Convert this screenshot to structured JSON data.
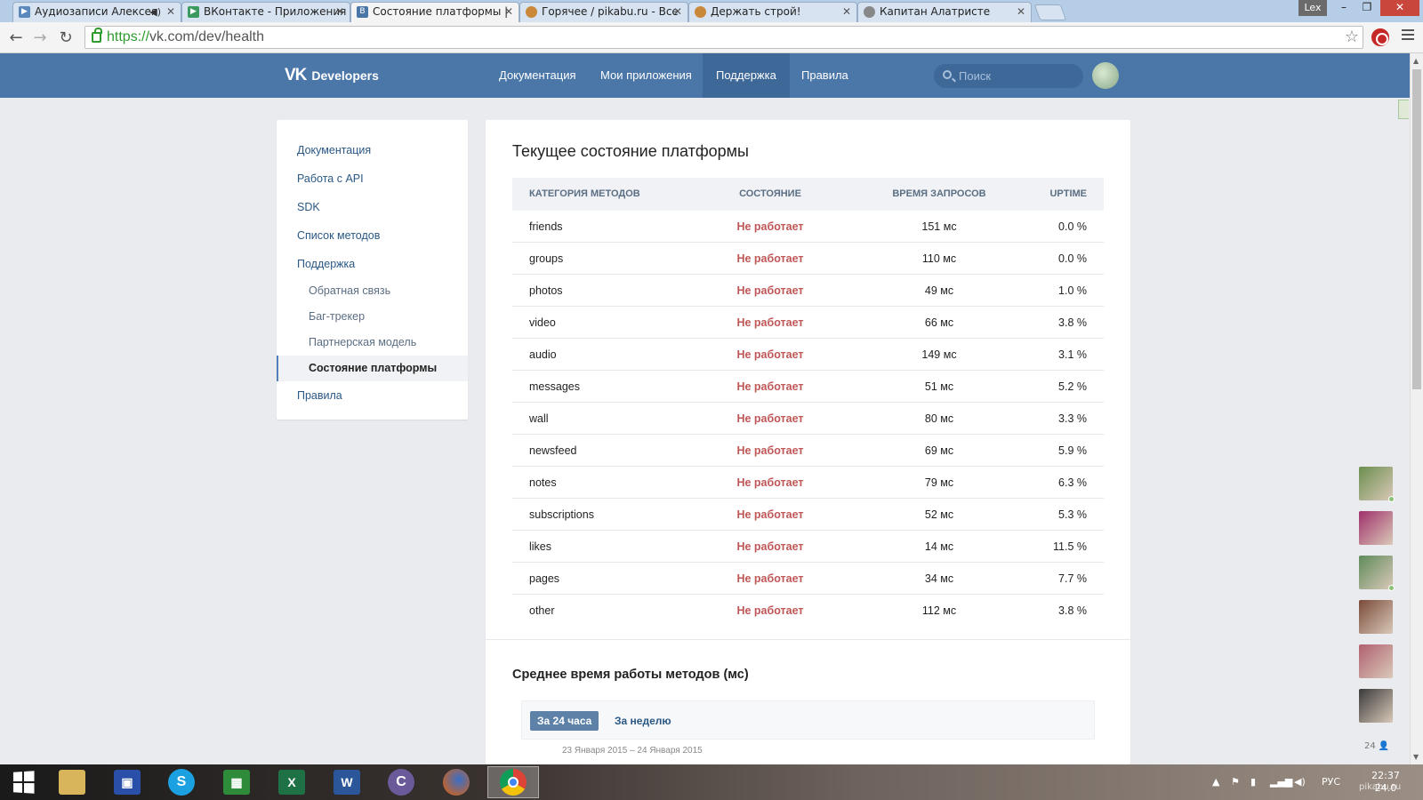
{
  "browser": {
    "tabs": [
      {
        "title": "Аудиозаписи Алексея",
        "favicon_color": "#5b88bd"
      },
      {
        "title": "ВКонтакте - Приложения",
        "favicon_color": "#3c9a5f"
      },
      {
        "title": "Состояние платформы |",
        "favicon_color": "#4a76a8",
        "favicon_letter": "B"
      },
      {
        "title": "Горячее / pikabu.ru - Все",
        "favicon_color": "#c9883a"
      },
      {
        "title": "Держать строй!",
        "favicon_color": "#c9883a"
      },
      {
        "title": "Капитан Алатристе",
        "favicon_color": "#888888"
      }
    ],
    "window_user": "Lex",
    "url_scheme": "https://",
    "url_rest": "vk.com/dev/health"
  },
  "header": {
    "logo_text": "Developers",
    "nav": [
      "Документация",
      "Мои приложения",
      "Поддержка",
      "Правила"
    ],
    "search_placeholder": "Поиск"
  },
  "sidebar": {
    "items": [
      {
        "label": "Документация"
      },
      {
        "label": "Работа с API"
      },
      {
        "label": "SDK"
      },
      {
        "label": "Список методов"
      },
      {
        "label": "Поддержка"
      }
    ],
    "sub_items": [
      {
        "label": "Обратная связь"
      },
      {
        "label": "Баг-трекер"
      },
      {
        "label": "Партнерская модель"
      },
      {
        "label": "Состояние платформы"
      }
    ],
    "last_item": "Правила"
  },
  "main": {
    "title": "Текущее состояние платформы",
    "columns": [
      "КАТЕГОРИЯ МЕТОДОВ",
      "СОСТОЯНИЕ",
      "ВРЕМЯ ЗАПРОСОВ",
      "UPTIME"
    ],
    "rows": [
      {
        "category": "friends",
        "status": "Не работает",
        "time": "151 мс",
        "uptime": "0.0 %"
      },
      {
        "category": "groups",
        "status": "Не работает",
        "time": "110 мс",
        "uptime": "0.0 %"
      },
      {
        "category": "photos",
        "status": "Не работает",
        "time": "49 мс",
        "uptime": "1.0 %"
      },
      {
        "category": "video",
        "status": "Не работает",
        "time": "66 мс",
        "uptime": "3.8 %"
      },
      {
        "category": "audio",
        "status": "Не работает",
        "time": "149 мс",
        "uptime": "3.1 %"
      },
      {
        "category": "messages",
        "status": "Не работает",
        "time": "51 мс",
        "uptime": "5.2 %"
      },
      {
        "category": "wall",
        "status": "Не работает",
        "time": "80 мс",
        "uptime": "3.3 %"
      },
      {
        "category": "newsfeed",
        "status": "Не работает",
        "time": "69 мс",
        "uptime": "5.9 %"
      },
      {
        "category": "notes",
        "status": "Не работает",
        "time": "79 мс",
        "uptime": "6.3 %"
      },
      {
        "category": "subscriptions",
        "status": "Не работает",
        "time": "52 мс",
        "uptime": "5.3 %"
      },
      {
        "category": "likes",
        "status": "Не работает",
        "time": "14 мс",
        "uptime": "11.5 %"
      },
      {
        "category": "pages",
        "status": "Не работает",
        "time": "34 мс",
        "uptime": "7.7 %"
      },
      {
        "category": "other",
        "status": "Не работает",
        "time": "112 мс",
        "uptime": "3.8 %"
      }
    ],
    "section_title": "Среднее время работы методов (мс)",
    "period_tabs": [
      "За 24 часа",
      "За неделю"
    ],
    "date_range": "23 Января 2015 – 24 Января 2015"
  },
  "friends_column": {
    "avatar_colors": [
      "#6b8e4e",
      "#a0306a",
      "#5e8a5a",
      "#7a4a3a",
      "#b06070",
      "#3a3a3a"
    ],
    "count": "24"
  },
  "taskbar": {
    "language": "РУС",
    "time": "22:37",
    "date": "24.0"
  },
  "watermark": "pikabu.ru",
  "colors": {
    "vk_blue": "#4a76a8",
    "status_red": "#c05757",
    "link": "#2a5885"
  }
}
